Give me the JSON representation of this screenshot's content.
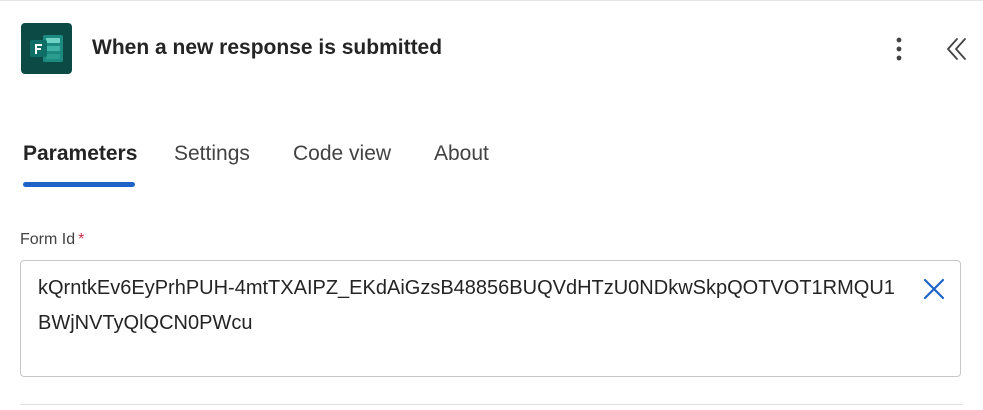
{
  "header": {
    "title": "When a new response is submitted",
    "app_icon": "microsoft-forms-icon",
    "more_icon": "more-vertical-icon",
    "collapse_icon": "double-chevron-left-icon"
  },
  "tabs": [
    {
      "label": "Parameters",
      "active": true
    },
    {
      "label": "Settings",
      "active": false
    },
    {
      "label": "Code view",
      "active": false
    },
    {
      "label": "About",
      "active": false
    }
  ],
  "form": {
    "field_label": "Form Id",
    "required_mark": "*",
    "value": "kQrntkEv6EyPrhPUH-4mtTXAIPZ_EKdAiGzsB48856BUQVdHTzU0NDkwSkpQOTVOT1RMQU1BWjNVTyQlQCN0PWcu",
    "clear_icon": "close-icon"
  },
  "colors": {
    "accent": "#1e64c8",
    "icon_bg": "#0b4a45",
    "required": "#c4314b"
  }
}
